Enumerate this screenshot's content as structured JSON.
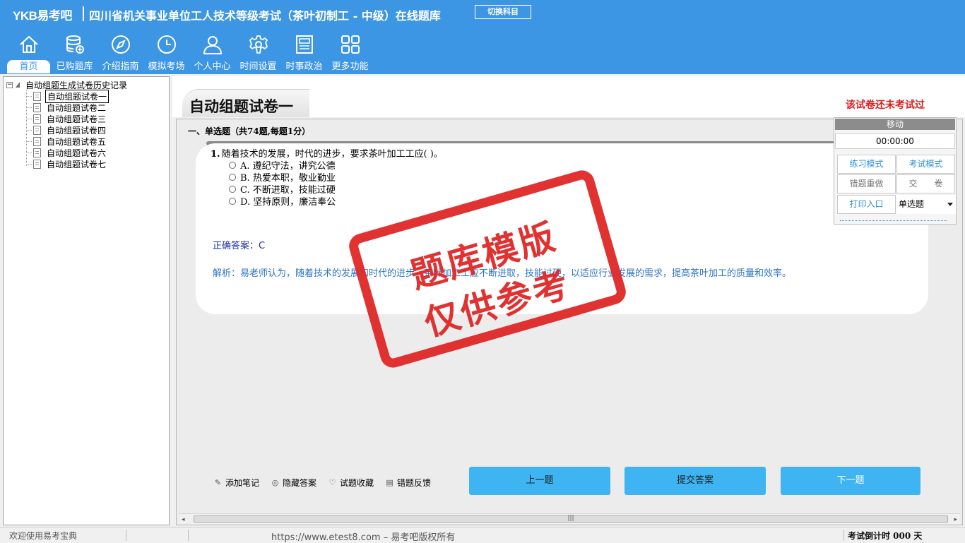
{
  "header": {
    "brand": "YKB易考吧",
    "title": "四川省机关事业单位工人技术等级考试（茶叶初制工 - 中级）在线题库",
    "switch_label": "切换科目"
  },
  "nav": [
    {
      "label": "首页",
      "icon": "home-icon",
      "active": true
    },
    {
      "label": "已购题库",
      "icon": "database-icon"
    },
    {
      "label": "介绍指南",
      "icon": "compass-icon"
    },
    {
      "label": "模拟考场",
      "icon": "clock-icon"
    },
    {
      "label": "个人中心",
      "icon": "user-icon"
    },
    {
      "label": "时间设置",
      "icon": "gear-icon"
    },
    {
      "label": "时事政治",
      "icon": "newspaper-icon"
    },
    {
      "label": "更多功能",
      "icon": "grid-icon"
    }
  ],
  "tree": {
    "root": "自动组题生成试卷历史记录",
    "items": [
      "自动组题试卷一",
      "自动组题试卷二",
      "自动组题试卷三",
      "自动组题试卷四",
      "自动组题试卷五",
      "自动组题试卷六",
      "自动组题试卷七"
    ],
    "selected_index": 0
  },
  "paper": {
    "title": "自动组题试卷一",
    "status": "该试卷还未考试过"
  },
  "section": {
    "title": "一、单选题（共74题,每题1分）"
  },
  "question": {
    "number": "1.",
    "text": "随着技术的发展，时代的进步，要求茶叶加工工应( )。",
    "options": [
      "A. 遵纪守法，讲究公德",
      "B. 热爱本职，敬业勤业",
      "C. 不断进取，技能过硬",
      "D. 坚持原则，廉洁奉公"
    ],
    "answer": "正确答案：C",
    "analysis": "解析：易老师认为，随着技术的发展和时代的进步，茶叶加工工应不断进取，技能过硬，以适应行业发展的需求，提高茶叶加工的质量和效率。"
  },
  "watermark": {
    "line1": "题库模版",
    "line2": "仅供参考",
    "color": "#e02626"
  },
  "tools": [
    {
      "label": "添加笔记",
      "icon": "pencil-icon"
    },
    {
      "label": "隐藏答案",
      "icon": "eye-icon"
    },
    {
      "label": "试题收藏",
      "icon": "heart-icon"
    },
    {
      "label": "错题反馈",
      "icon": "feedback-icon"
    }
  ],
  "buttons": {
    "prev": "上一题",
    "submit": "提交答案",
    "next": "下一题"
  },
  "control_panel": {
    "move": "移动",
    "timer": "00:00:00",
    "practice_mode": "练习模式",
    "exam_mode": "考试模式",
    "redo_wrong": "错题重做",
    "hand_in": "交　　卷",
    "print": "打印入口",
    "question_type": "单选题"
  },
  "status_bar": {
    "welcome": "欢迎使用易考宝典",
    "copyright": "https://www.etest8.com – 易考吧版权所有",
    "countdown": "考试倒计时 000 天"
  },
  "colors": {
    "header_bg": "#3d96e4",
    "button_bg": "#3eb5f2",
    "warning_red": "#d82020",
    "answer_blue": "#1c2fa8",
    "analysis_blue": "#2c74c4"
  }
}
